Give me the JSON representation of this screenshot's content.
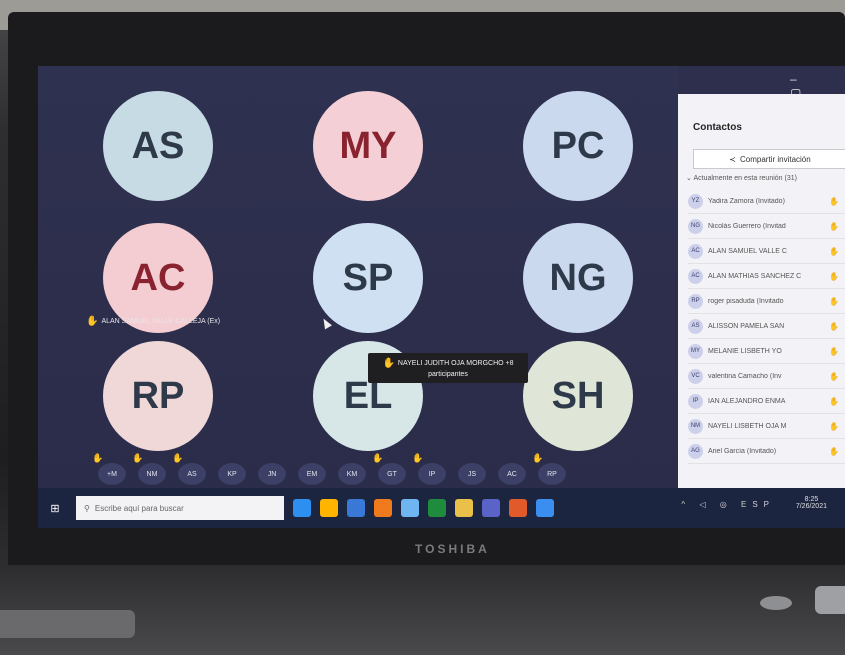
{
  "device": {
    "brand": "TOSHIBA"
  },
  "window": {
    "controls": "– ▢"
  },
  "grid": [
    {
      "initials": "AS",
      "color": "#c6dbe3"
    },
    {
      "initials": "MY",
      "color": "#f4cfd5",
      "text_color": "#8a2330"
    },
    {
      "initials": "PC",
      "color": "#cbd9ee"
    },
    {
      "initials": "AC",
      "color": "#f4cdd2",
      "text_color": "#8a2330"
    },
    {
      "initials": "SP",
      "color": "#cfe0f2"
    },
    {
      "initials": "NG",
      "color": "#cbd9ee"
    },
    {
      "initials": "RP",
      "color": "#f0d8d9"
    },
    {
      "initials": "EL",
      "color": "#d7e6e7"
    },
    {
      "initials": "SH",
      "color": "#dfe6d8"
    }
  ],
  "hand_label": "ALAN SAMUEL VALLE CALLEJA (Ex)",
  "tooltip": {
    "line1": "NAYELI JUDITH OJA MORGCHO +8",
    "line2": "participantes"
  },
  "tray": [
    {
      "initials": "+M",
      "hand": true
    },
    {
      "initials": "NM",
      "hand": true
    },
    {
      "initials": "AS",
      "hand": true
    },
    {
      "initials": "KP",
      "hand": false
    },
    {
      "initials": "JN",
      "hand": false
    },
    {
      "initials": "EM",
      "hand": false
    },
    {
      "initials": "KM",
      "hand": false
    },
    {
      "initials": "GT",
      "hand": true
    },
    {
      "initials": "IP",
      "hand": true
    },
    {
      "initials": "JS",
      "hand": false
    },
    {
      "initials": "AC",
      "hand": false
    },
    {
      "initials": "RP",
      "hand": true
    }
  ],
  "panel": {
    "title": "Contactos",
    "invite_label": "Compartir invitación",
    "section": "Actualmente en esta reunión (31)",
    "participants": [
      {
        "initials": "YZ",
        "name": "Yadira Zamora (Invitado)"
      },
      {
        "initials": "NG",
        "name": "Nicolás Guerrero (Invitad"
      },
      {
        "initials": "AC",
        "name": "ALAN SAMUEL VALLE C"
      },
      {
        "initials": "AC",
        "name": "ALAN MATHIAS SANCHEZ C"
      },
      {
        "initials": "RP",
        "name": "roger pisaduda (Invitado"
      },
      {
        "initials": "AS",
        "name": "ALISSON PAMELA SAN"
      },
      {
        "initials": "MY",
        "name": "MELANIE LISBETH YO"
      },
      {
        "initials": "VC",
        "name": "valentina Camacho (Inv"
      },
      {
        "initials": "IP",
        "name": "IAN ALEJANDRO ENMA"
      },
      {
        "initials": "NM",
        "name": "NAYELI LISBETH OJA M"
      },
      {
        "initials": "AG",
        "name": "Ariel García (Invitado)"
      }
    ]
  },
  "taskbar": {
    "search_placeholder": "Escribe aquí para buscar",
    "apps": [
      "#2d8ff0",
      "#ffb400",
      "#3a78d8",
      "#f07a1e",
      "#6fb6f0",
      "#1e8c3c",
      "#e8c04a",
      "#5a63c8",
      "#e05a2a",
      "#3a8ef0"
    ],
    "time": "8:25",
    "date": "7/26/2021",
    "lang": "ESP"
  }
}
